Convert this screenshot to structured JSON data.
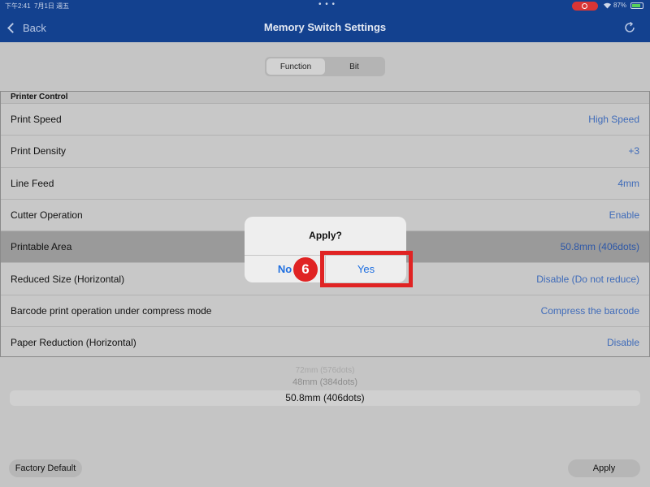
{
  "status_bar": {
    "time": "下午2:41",
    "date": "7月1日 週五",
    "battery": "87%",
    "dots": "• • •"
  },
  "nav": {
    "back_label": "Back",
    "title": "Memory Switch Settings",
    "refresh_icon": "refresh-icon"
  },
  "segment": {
    "tabs": [
      {
        "label": "Function",
        "active": true
      },
      {
        "label": "Bit",
        "active": false
      }
    ]
  },
  "table": {
    "section_title": "Printer Control",
    "rows": [
      {
        "label": "Print Speed",
        "value": "High Speed"
      },
      {
        "label": "Print Density",
        "value": "+3"
      },
      {
        "label": "Line Feed",
        "value": "4mm"
      },
      {
        "label": "Cutter Operation",
        "value": "Enable"
      },
      {
        "label": "Printable Area",
        "value": "50.8mm (406dots)",
        "selected": true
      },
      {
        "label": "Reduced Size (Horizontal)",
        "value": "Disable (Do not reduce)"
      },
      {
        "label": "Barcode print operation under compress mode",
        "value": "Compress the barcode"
      },
      {
        "label": "Paper Reduction (Horizontal)",
        "value": "Disable"
      }
    ]
  },
  "picker": {
    "options": [
      "72mm (576dots)",
      "48mm (384dots)",
      "50.8mm (406dots)"
    ],
    "selected": "50.8mm (406dots)"
  },
  "footer": {
    "factory_default": "Factory Default",
    "apply": "Apply"
  },
  "dialog": {
    "title": "Apply?",
    "no_label": "No",
    "yes_label": "Yes"
  },
  "annotation": {
    "step_number": "6",
    "color": "#e02323"
  },
  "colors": {
    "nav_blue": "#13418f",
    "link_blue": "#3f6bb9",
    "dialog_button_blue": "#1f6fe0"
  }
}
